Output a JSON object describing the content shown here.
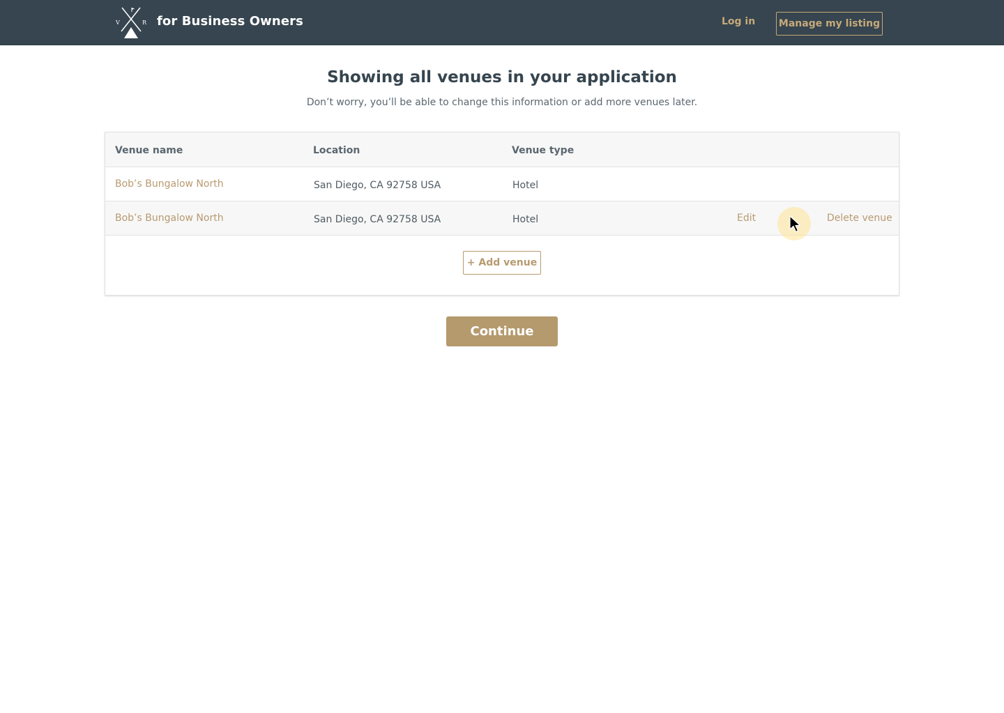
{
  "header": {
    "brand_text": "for Business Owners",
    "login_label": "Log in",
    "manage_label": "Manage my listing",
    "logo_icon": "venue-report-logo-icon",
    "logo_letters": [
      "V",
      "R"
    ]
  },
  "main": {
    "title": "Showing all venues in your application",
    "subtitle": "Don’t worry, you’ll be able to change this information or add more venues later."
  },
  "table": {
    "columns": [
      "Venue name",
      "Location",
      "Venue type"
    ],
    "rows": [
      {
        "name": "Bob’s Bungalow North",
        "location": "San Diego, CA 92758 USA",
        "type": "Hotel"
      },
      {
        "name": "Bob’s Bungalow North",
        "location": "San Diego, CA 92758 USA",
        "type": "Hotel",
        "edit_label": "Edit",
        "delete_label": "Delete venue"
      }
    ],
    "add_label": "+ Add venue"
  },
  "actions": {
    "continue_label": "Continue"
  },
  "colors": {
    "header_bg": "#36454f",
    "accent": "#b79b70",
    "button_bg": "#b59a6e"
  }
}
